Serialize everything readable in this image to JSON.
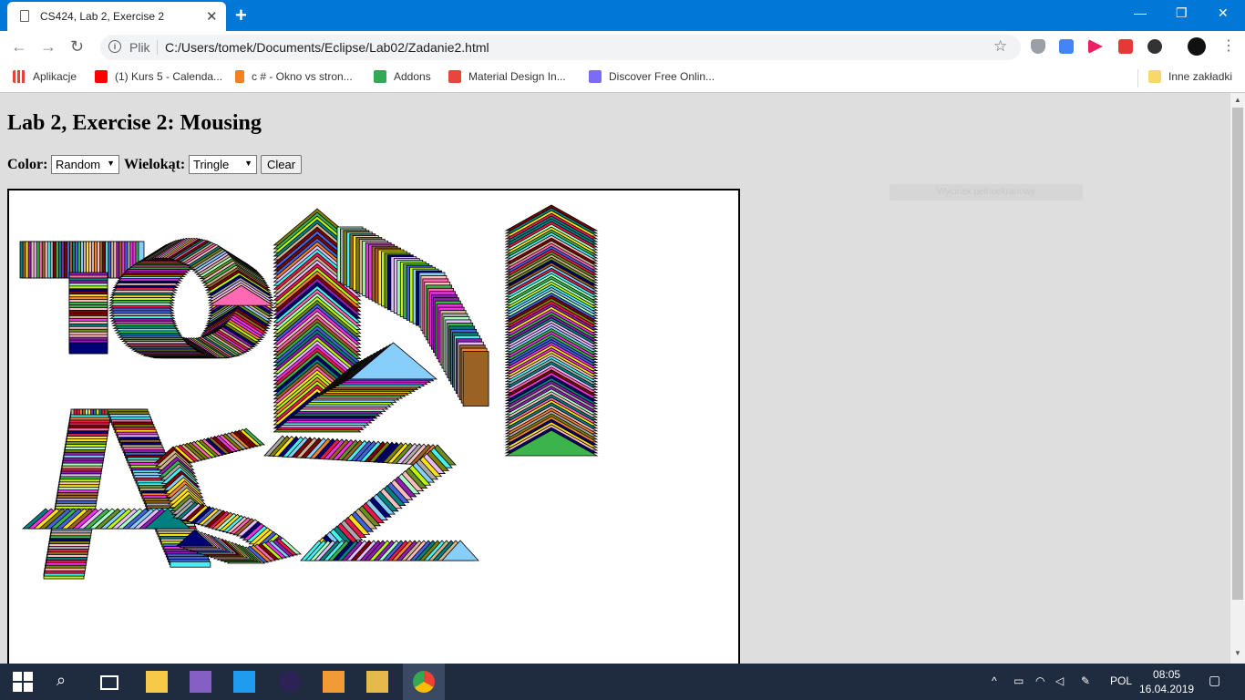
{
  "browser": {
    "tab_title": "CS424, Lab 2, Exercise 2",
    "omnibox_label": "Plik",
    "url": "C:/Users/tomek/Documents/Eclipse/Lab02/Zadanie2.html"
  },
  "bookmarks": {
    "items": [
      {
        "label": "Aplikacje",
        "color": "#e94235"
      },
      {
        "label": "(1) Kurs 5 - Calenda...",
        "color": "#ff0000"
      },
      {
        "label": "c # - Okno vs stron...",
        "color": "#f48024"
      },
      {
        "label": "Addons",
        "color": "#34a853"
      },
      {
        "label": "Material Design In...",
        "color": "#e8453c"
      },
      {
        "label": "Discover Free Onlin...",
        "color": "#7b6cf6"
      }
    ],
    "other": "Inne zakładki"
  },
  "page": {
    "heading": "Lab 2, Exercise 2: Mousing",
    "color_label": "Color:",
    "color_value": "Random",
    "polygon_label": "Wielokąt:",
    "polygon_value": "Tringle",
    "clear_label": "Clear",
    "hover_tip": "Wycinek pełnoekranowy"
  },
  "taskbar": {
    "language": "POL",
    "time": "08:05",
    "date": "16.04.2019"
  }
}
